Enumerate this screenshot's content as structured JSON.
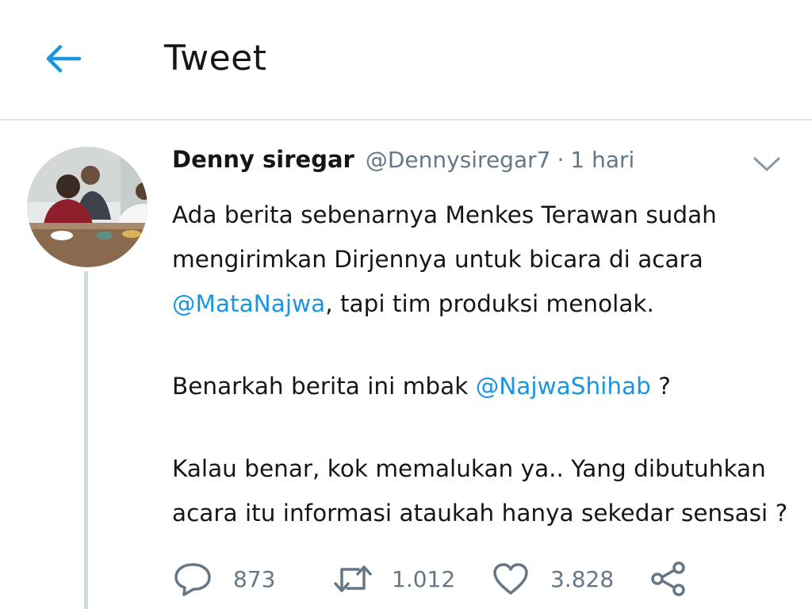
{
  "header": {
    "title": "Tweet"
  },
  "tweet": {
    "author": {
      "display_name": "Denny siregar",
      "handle": "@Dennysiregar7"
    },
    "separator": "·",
    "time": "1 hari",
    "body": {
      "p1": {
        "line1": "Ada berita sebenarnya Menkes Terawan sudah",
        "line2": "mengirimkan Dirjennya untuk bicara di acara",
        "mention": "@MataNajwa",
        "after": ", tapi tim produksi menolak."
      },
      "p2": {
        "before": "Benarkah berita ini mbak ",
        "mention": "@NajwaShihab",
        "after": " ?"
      },
      "p3": {
        "line1": "Kalau benar, kok memalukan ya.. Yang dibutuhkan",
        "line2": "acara itu informasi ataukah hanya sekedar sensasi ?"
      }
    },
    "actions": {
      "replies": "873",
      "retweets": "1.012",
      "likes": "3.828"
    }
  },
  "colors": {
    "accent": "#1b95e0",
    "text": "#14171a",
    "muted": "#657786",
    "divider": "#e1e8ed"
  },
  "icons": [
    "back-arrow-icon",
    "chevron-down-icon",
    "reply-icon",
    "retweet-icon",
    "like-icon",
    "share-icon"
  ]
}
